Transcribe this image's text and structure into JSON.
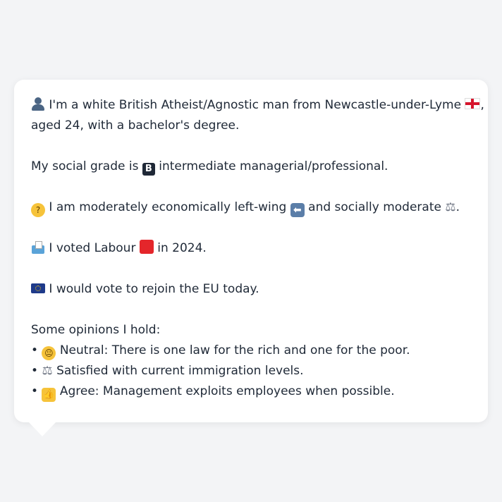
{
  "profile": {
    "identity": {
      "text": " I'm a white British Atheist/Agnostic man from Newcastle-under-Lyme ",
      "after_flag": ",",
      "line2": "aged 24, with a bachelor's degree."
    },
    "social_grade": {
      "prefix": "My social grade is ",
      "badge": "B",
      "suffix": " intermediate managerial/professional."
    },
    "ideology": {
      "part1": " I am moderately economically left-wing ",
      "arrow": "⬅",
      "part2": " and socially moderate ",
      "scales": "⚖",
      "end": "."
    },
    "vote": {
      "part1": " I voted Labour ",
      "part2": " in 2024."
    },
    "eu": {
      "text": " I would vote to rejoin the EU today."
    },
    "opinions": {
      "heading": "Some opinions I hold:",
      "bullet": "•",
      "items": [
        {
          "icon": "neutral-face-icon",
          "glyph": "😐",
          "text": " Neutral: There is one law for the rich and one for the poor."
        },
        {
          "icon": "scales-icon",
          "glyph": "⚖",
          "text": " Satisfied with current immigration levels."
        },
        {
          "icon": "thumbs-up-icon",
          "glyph": "👍",
          "text": " Agree: Management exploits employees when possible."
        }
      ]
    }
  },
  "colors": {
    "background": "#f3f4f6",
    "bubble": "#ffffff",
    "text": "#1f2937",
    "labour_red": "#e4262b"
  }
}
